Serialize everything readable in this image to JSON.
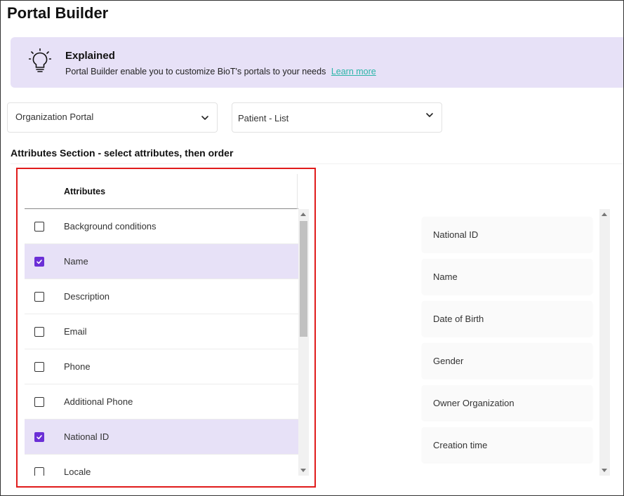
{
  "page": {
    "title": "Portal Builder"
  },
  "banner": {
    "icon": "lightbulb-icon",
    "title": "Explained",
    "text": "Portal Builder enable you to customize BioT's portals to your needs",
    "link_label": "Learn more",
    "background": "#e7e1f7",
    "link_color": "#2bb5a8"
  },
  "selectors": {
    "portal": {
      "value": "Organization Portal"
    },
    "view": {
      "value": "Patient - List"
    }
  },
  "section": {
    "title": "Attributes Section - select attributes, then order"
  },
  "attributes_table": {
    "header": "Attributes",
    "rows": [
      {
        "label": "Background conditions",
        "checked": false
      },
      {
        "label": "Name",
        "checked": true
      },
      {
        "label": "Description",
        "checked": false
      },
      {
        "label": "Email",
        "checked": false
      },
      {
        "label": "Phone",
        "checked": false
      },
      {
        "label": "Additional Phone",
        "checked": false
      },
      {
        "label": "National ID",
        "checked": true
      },
      {
        "label": "Locale",
        "checked": false
      }
    ]
  },
  "ordered_attributes": [
    "National ID",
    "Name",
    "Date of Birth",
    "Gender",
    "Owner Organization",
    "Creation time"
  ],
  "colors": {
    "accent": "#6b2fd6",
    "highlight_box": "#e01b1b",
    "selected_row": "#e7e1f7"
  }
}
